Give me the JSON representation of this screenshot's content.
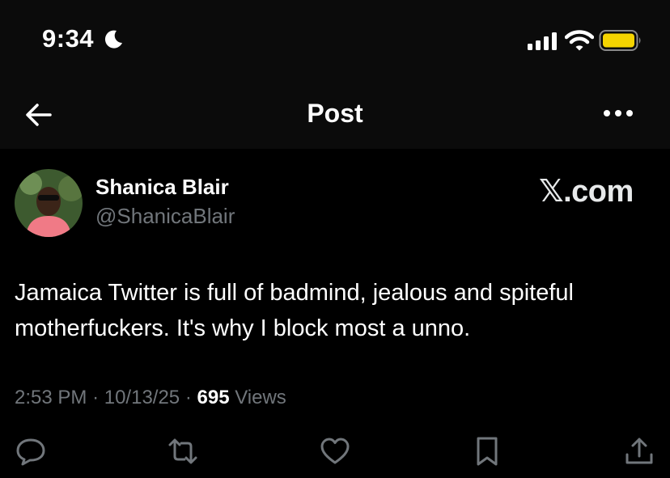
{
  "status_bar": {
    "time": "9:34",
    "moon_icon": "moon-icon",
    "signal_icon": "cellular-signal-icon",
    "wifi_icon": "wifi-icon",
    "battery_icon": "battery-icon",
    "battery_color": "#f5d400"
  },
  "nav": {
    "back_icon": "arrow-left-icon",
    "title": "Post",
    "more_icon": "more-horizontal-icon"
  },
  "post": {
    "display_name": "Shanica Blair",
    "handle": "@ShanicaBlair",
    "watermark": "𝕏.com",
    "text": "Jamaica Twitter is full of badmind, jealous and spiteful motherfuckers. It's why I block most a unno.",
    "time": "2:53 PM",
    "date": "10/13/25",
    "separator": "·",
    "views_count": "695",
    "views_label": "Views"
  },
  "actions": {
    "reply_icon": "reply-icon",
    "repost_icon": "repost-icon",
    "like_icon": "like-icon",
    "bookmark_icon": "bookmark-icon",
    "share_icon": "share-icon"
  },
  "colors": {
    "background": "#000000",
    "header_background": "#0b0b0b",
    "text_primary": "#ffffff",
    "text_secondary": "#71767b"
  }
}
